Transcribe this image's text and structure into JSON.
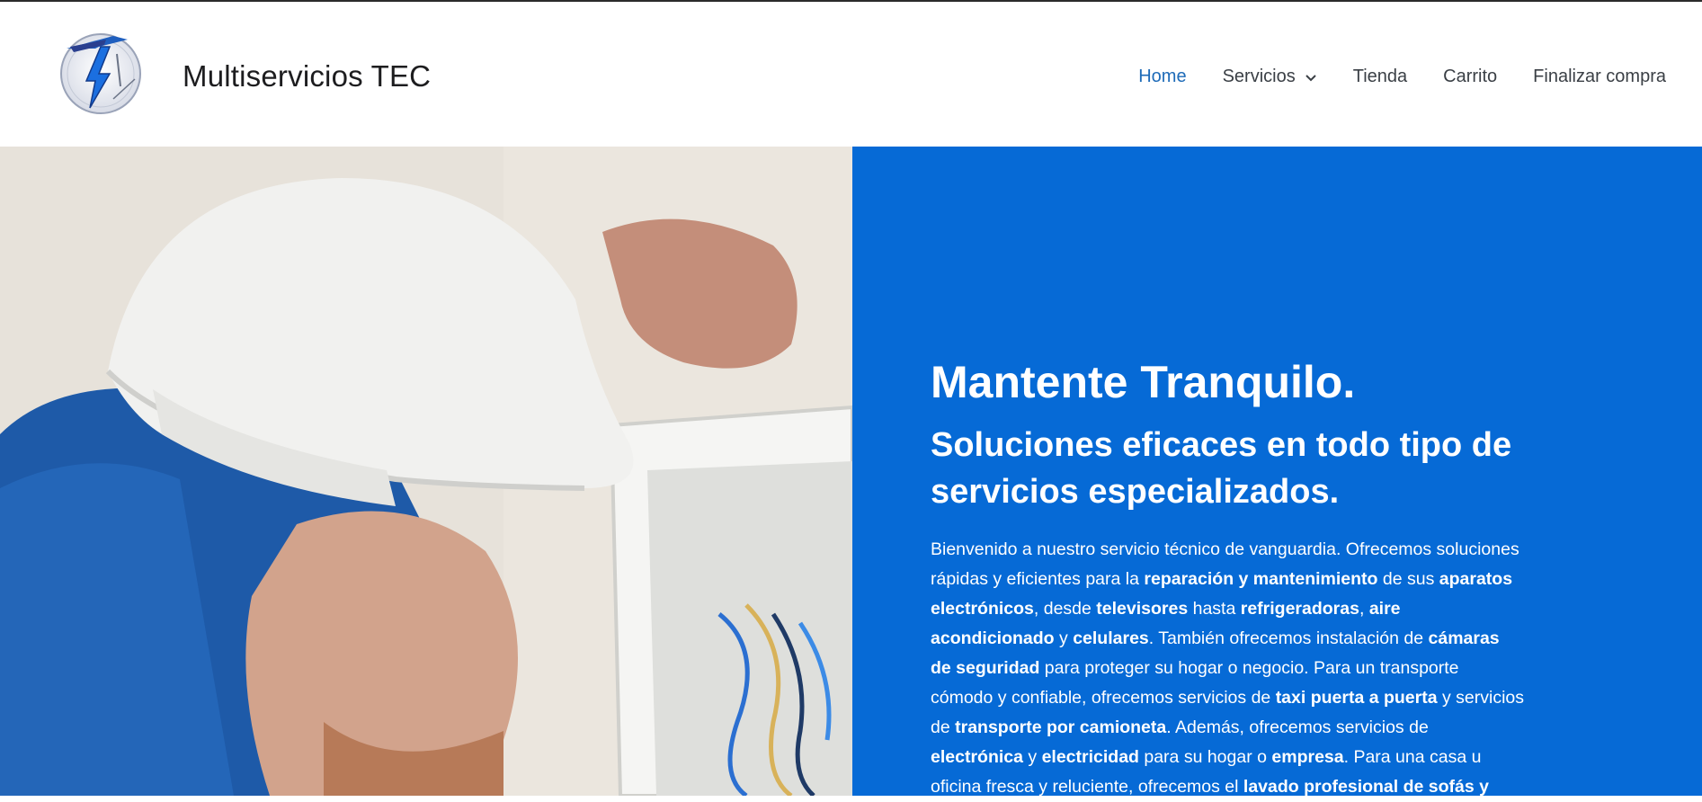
{
  "site": {
    "title": "Multiservicios TEC"
  },
  "nav": {
    "items": [
      {
        "label": "Home",
        "active": true
      },
      {
        "label": "Servicios",
        "has_dropdown": true
      },
      {
        "label": "Tienda"
      },
      {
        "label": "Carrito"
      },
      {
        "label": "Finalizar compra"
      }
    ]
  },
  "hero": {
    "headline": "Mantente Tranquilo.",
    "subheadline": "Soluciones eficaces en todo tipo de servicios especializados.",
    "intro": [
      {
        "t": "Bienvenido a nuestro servicio técnico de vanguardia. Ofrecemos soluciones rápidas y eficientes para la ",
        "b": false
      },
      {
        "t": "reparación y mantenimiento",
        "b": true
      },
      {
        "t": " de sus ",
        "b": false
      },
      {
        "t": "aparatos electrónicos",
        "b": true
      },
      {
        "t": ", desde ",
        "b": false
      },
      {
        "t": "televisores",
        "b": true
      },
      {
        "t": " hasta ",
        "b": false
      },
      {
        "t": "refrigeradoras",
        "b": true
      },
      {
        "t": ", ",
        "b": false
      },
      {
        "t": "aire acondicionado",
        "b": true
      },
      {
        "t": " y ",
        "b": false
      },
      {
        "t": "celulares",
        "b": true
      },
      {
        "t": ". También ofrecemos instalación de ",
        "b": false
      },
      {
        "t": "cámaras de seguridad",
        "b": true
      },
      {
        "t": " para proteger su hogar o negocio. Para un transporte cómodo y confiable, ofrecemos servicios de ",
        "b": false
      },
      {
        "t": "taxi puerta a puerta",
        "b": true
      },
      {
        "t": " y servicios de ",
        "b": false
      },
      {
        "t": "transporte por camioneta",
        "b": true
      },
      {
        "t": ". Además, ofrecemos servicios de ",
        "b": false
      },
      {
        "t": "electrónica",
        "b": true
      },
      {
        "t": " y ",
        "b": false
      },
      {
        "t": "electricidad",
        "b": true
      },
      {
        "t": " para su hogar o ",
        "b": false
      },
      {
        "t": "empresa",
        "b": true
      },
      {
        "t": ". Para una casa u oficina fresca y reluciente, ofrecemos el ",
        "b": false
      },
      {
        "t": "lavado profesional de sofás y",
        "b": true
      }
    ]
  },
  "colors": {
    "accent_blue": "#066ad6",
    "nav_active": "#1e6bb8",
    "logo_blue": "#1f5fbf"
  },
  "icons": {
    "logo": "lightning-t-logo",
    "dropdown": "chevron-down-icon"
  }
}
